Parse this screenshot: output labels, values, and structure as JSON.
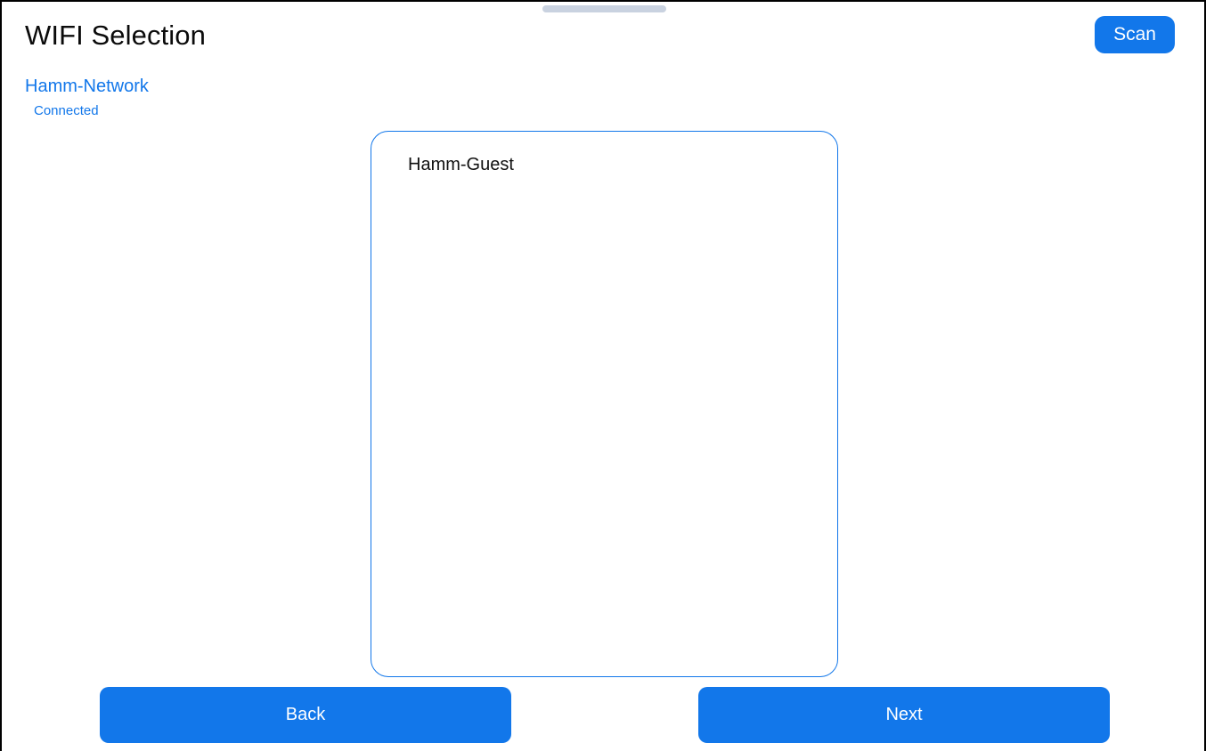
{
  "header": {
    "title": "WIFI Selection",
    "scan_label": "Scan"
  },
  "connected_network": {
    "name": "Hamm-Network",
    "status": "Connected"
  },
  "wifi_list": {
    "items": [
      {
        "label": "Hamm-Guest"
      }
    ]
  },
  "footer": {
    "back_label": "Back",
    "next_label": "Next"
  },
  "colors": {
    "accent": "#1277ea",
    "grabber": "#c9d2e0",
    "frame": "#000000"
  }
}
